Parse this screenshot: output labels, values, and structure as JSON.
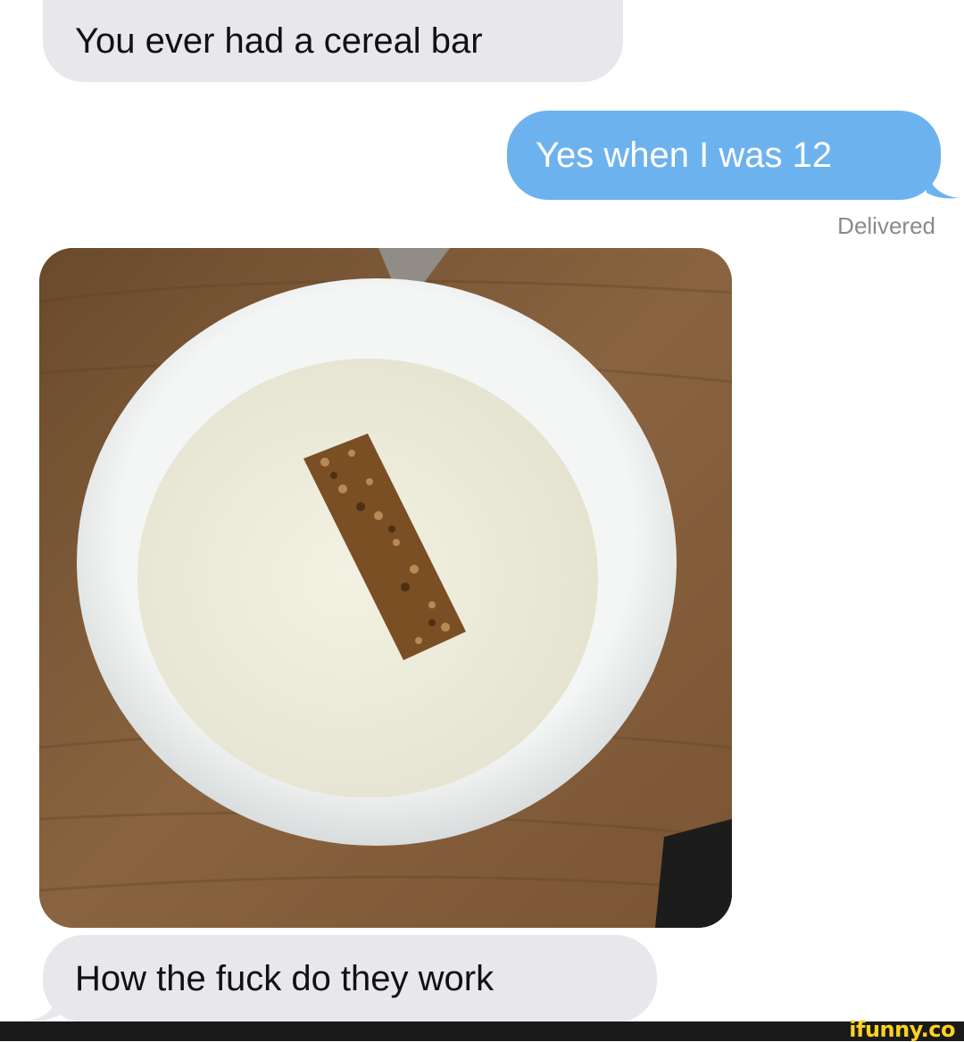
{
  "messages": [
    {
      "direction": "incoming",
      "text": "You ever had a cereal bar"
    },
    {
      "direction": "outgoing",
      "text": "Yes when I was 12"
    },
    {
      "direction": "incoming",
      "text": "How the fuck do they work"
    }
  ],
  "delivery_status": "Delivered",
  "photo": {
    "icon": "photo-icon"
  },
  "watermark": {
    "text": "ifunny.co"
  },
  "colors": {
    "incoming_bubble": "#e8e8ec",
    "outgoing_bubble": "#6cb2ee",
    "status_text": "#8a8a8e",
    "watermark": "#ffd21f"
  }
}
